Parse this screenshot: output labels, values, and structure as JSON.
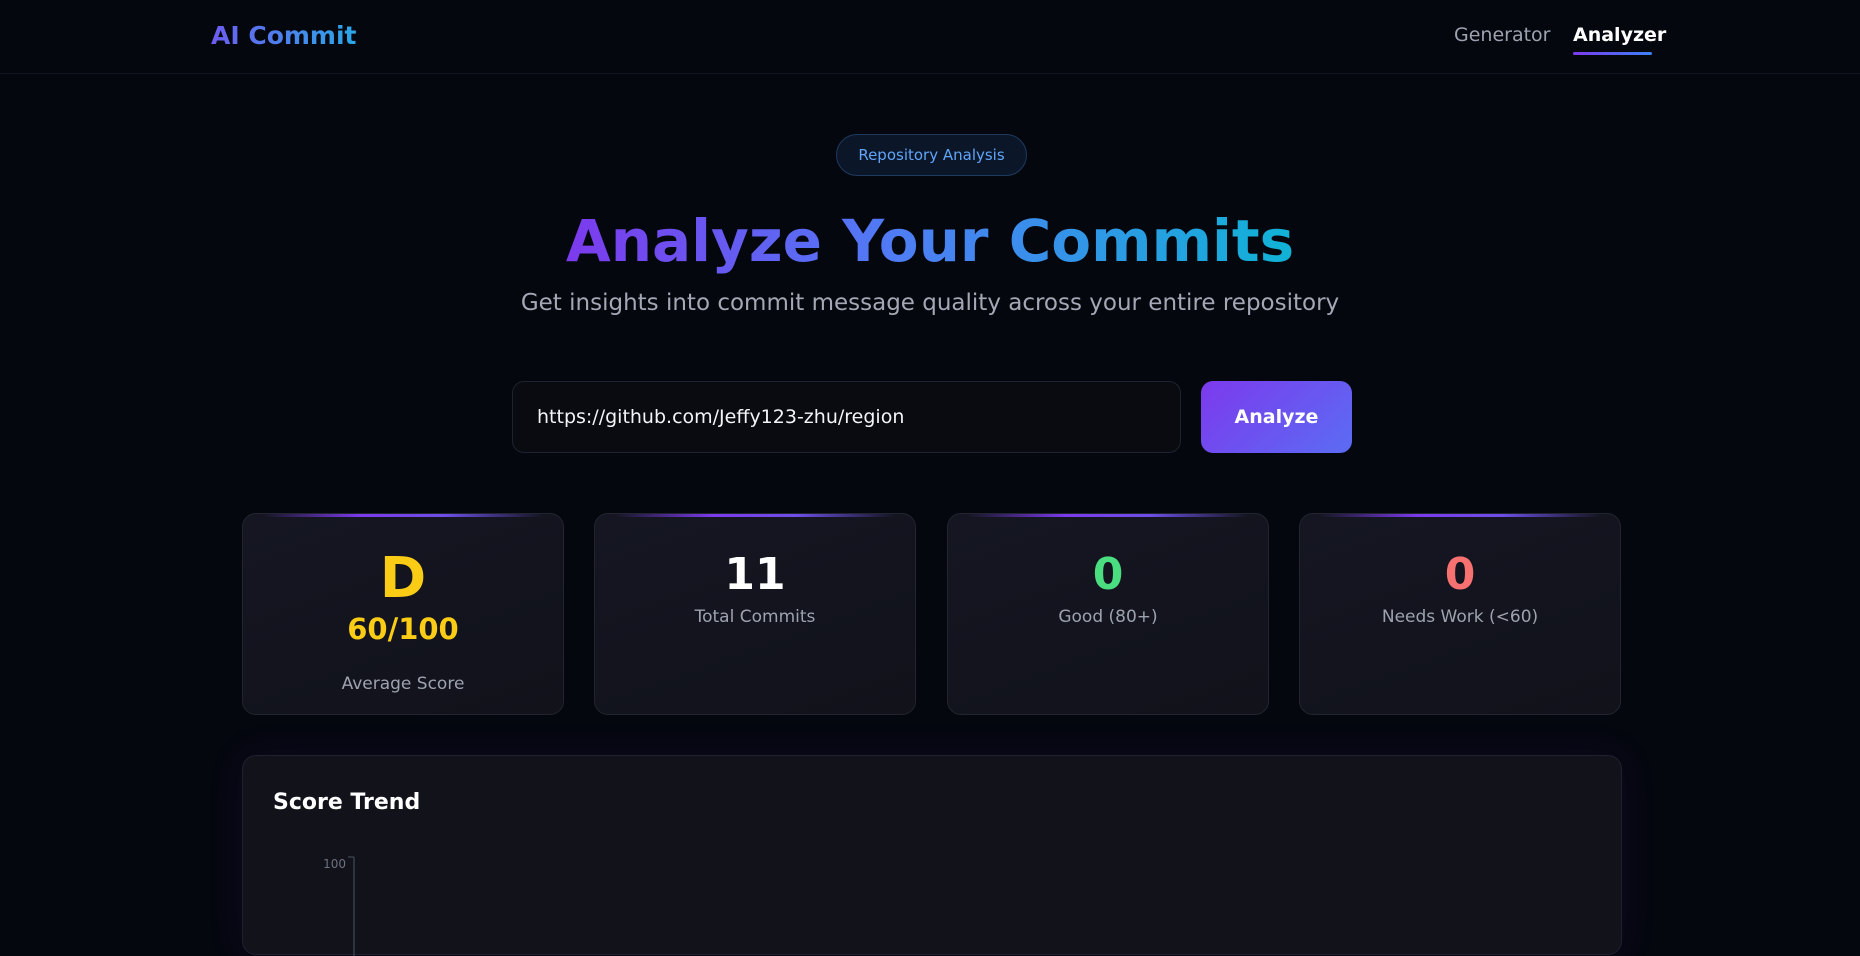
{
  "header": {
    "brand": "AI Commit",
    "nav": {
      "generator": "Generator",
      "analyzer": "Analyzer",
      "active": "Analyzer"
    }
  },
  "hero": {
    "badge": "Repository Analysis",
    "title": "Analyze Your Commits",
    "subtitle": "Get insights into commit message quality across your entire repository"
  },
  "search": {
    "value": "https://github.com/Jeffy123-zhu/region",
    "button": "Analyze"
  },
  "stats": {
    "grade": "D",
    "score": "60/100",
    "score_label": "Average Score",
    "total_commits": "11",
    "total_commits_label": "Total Commits",
    "good": "0",
    "good_label": "Good (80+)",
    "needs_work": "0",
    "needs_work_label": "Needs Work (<60)"
  },
  "colors": {
    "grade": "#facc15",
    "good": "#4ade80",
    "needs_work": "#f87171",
    "accent": "#7c3aed"
  },
  "trend": {
    "title": "Score Trend",
    "y_tick_top": "100"
  }
}
